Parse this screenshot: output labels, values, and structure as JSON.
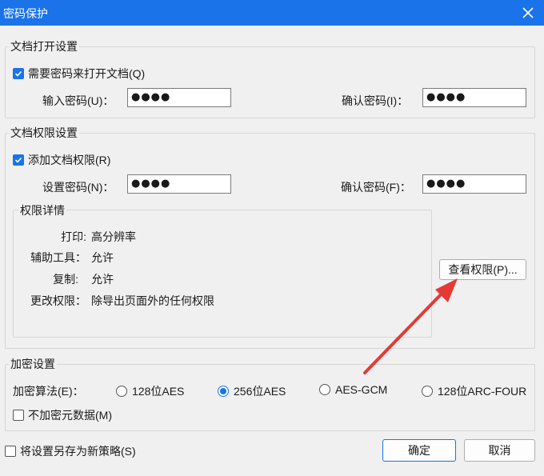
{
  "window": {
    "title": "密码保护"
  },
  "open_settings": {
    "group_title": "文档打开设置",
    "require_password_label": "需要密码来打开文档(Q)",
    "require_password_checked": true,
    "input_label": "输入密码(U)：",
    "input_value": "●●●●",
    "confirm_label": "确认密码(I)：",
    "confirm_value": "●●●●"
  },
  "permission_settings": {
    "group_title": "文档权限设置",
    "add_permission_label": "添加文档权限(R)",
    "add_permission_checked": true,
    "set_label": "设置密码(N)：",
    "set_value": "●●●●",
    "confirm_label": "确认密码(F)：",
    "confirm_value": "●●●●",
    "details": {
      "title": "权限详情",
      "rows": [
        {
          "key": "打印:",
          "value": "高分辨率"
        },
        {
          "key": "辅助工具：",
          "value": "允许"
        },
        {
          "key": "复制:",
          "value": "允许"
        },
        {
          "key": "更改权限：",
          "value": "除导出页面外的任何权限"
        }
      ]
    },
    "view_button": "查看权限(P)..."
  },
  "encryption": {
    "group_title": "加密设置",
    "algorithm_label": "加密算法(E)：",
    "options": [
      {
        "label": "128位AES",
        "selected": false
      },
      {
        "label": "256位AES",
        "selected": true
      },
      {
        "label": "AES-GCM",
        "selected": false
      },
      {
        "label": "128位ARC-FOUR",
        "selected": false
      }
    ],
    "no_metadata_label": "不加密元数据(M)",
    "no_metadata_checked": false
  },
  "footer": {
    "save_policy_label": "将设置另存为新策略(S)",
    "save_policy_checked": false,
    "ok_button": "确定",
    "cancel_button": "取消"
  },
  "colors": {
    "accent": "#1a73e8",
    "arrow": "#e53935"
  }
}
